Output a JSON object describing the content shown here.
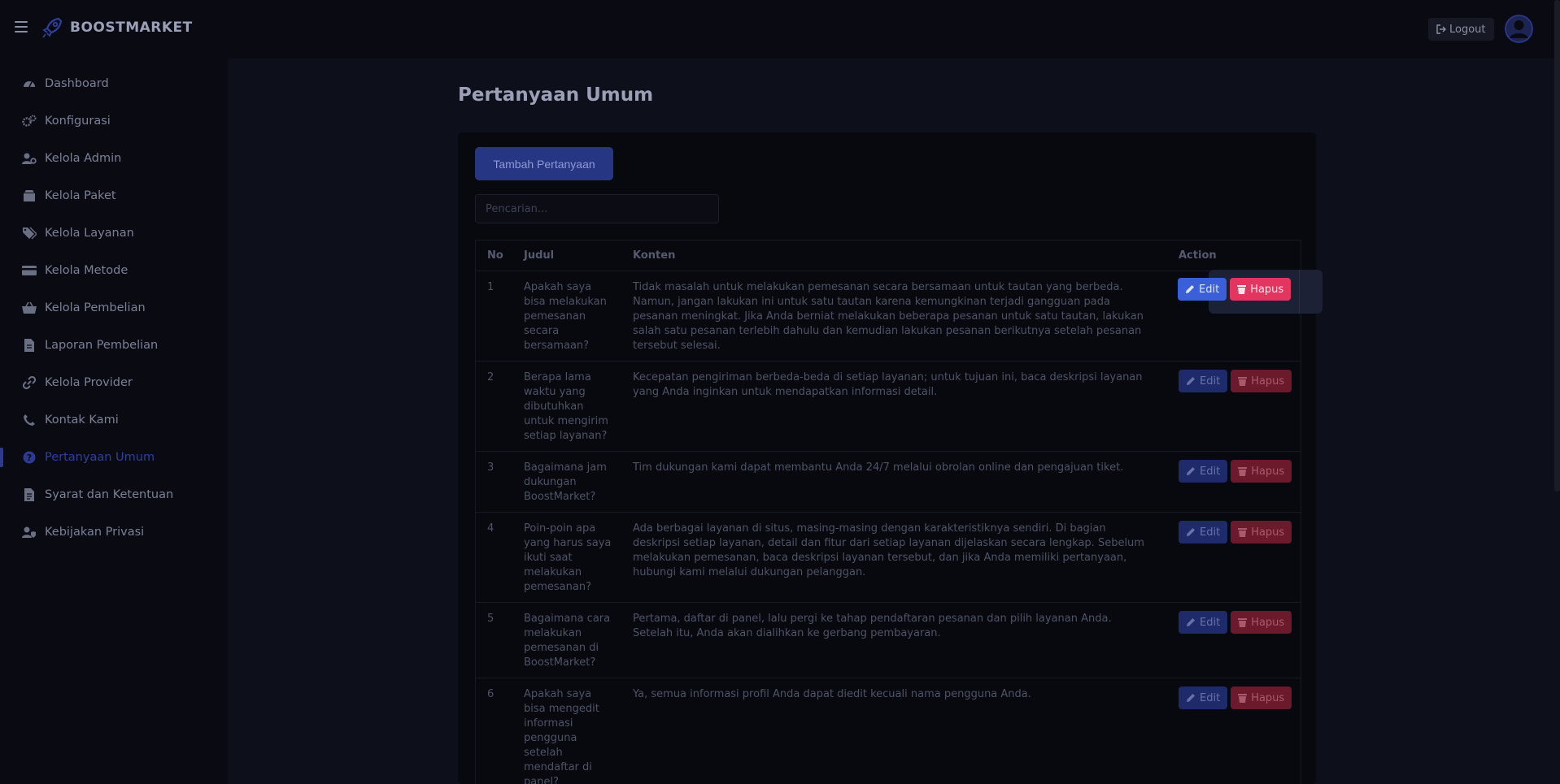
{
  "brand": {
    "name": "BOOSTMARKET"
  },
  "topbar": {
    "logout_label": "Logout"
  },
  "sidebar": {
    "items": [
      {
        "label": "Dashboard",
        "icon": "gauge-icon"
      },
      {
        "label": "Konfigurasi",
        "icon": "cogs-icon"
      },
      {
        "label": "Kelola Admin",
        "icon": "user-cog-icon"
      },
      {
        "label": "Kelola Paket",
        "icon": "box-icon"
      },
      {
        "label": "Kelola Layanan",
        "icon": "tags-icon"
      },
      {
        "label": "Kelola Metode",
        "icon": "credit-card-icon"
      },
      {
        "label": "Kelola Pembelian",
        "icon": "basket-icon"
      },
      {
        "label": "Laporan Pembelian",
        "icon": "file-icon"
      },
      {
        "label": "Kelola Provider",
        "icon": "link-icon"
      },
      {
        "label": "Kontak Kami",
        "icon": "phone-icon"
      },
      {
        "label": "Pertanyaan Umum",
        "icon": "question-circle-icon",
        "active": true
      },
      {
        "label": "Syarat dan Ketentuan",
        "icon": "file-text-icon"
      },
      {
        "label": "Kebijakan Privasi",
        "icon": "user-shield-icon"
      }
    ]
  },
  "main": {
    "title": "Pertanyaan Umum",
    "add_button": "Tambah Pertanyaan",
    "search_placeholder": "Pencarian..."
  },
  "table": {
    "headers": {
      "no": "No",
      "judul": "Judul",
      "konten": "Konten",
      "action": "Action"
    },
    "edit_label": "Edit",
    "hapus_label": "Hapus",
    "rows": [
      {
        "no": "1",
        "judul": "Apakah saya bisa melakukan pemesanan secara bersamaan?",
        "konten": "Tidak masalah untuk melakukan pemesanan secara bersamaan untuk tautan yang berbeda. Namun, jangan lakukan ini untuk satu tautan karena kemungkinan terjadi gangguan pada pesanan meningkat. Jika Anda berniat melakukan beberapa pesanan untuk satu tautan, lakukan salah satu pesanan terlebih dahulu dan kemudian lakukan pesanan berikutnya setelah pesanan tersebut selesai."
      },
      {
        "no": "2",
        "judul": "Berapa lama waktu yang dibutuhkan untuk mengirim setiap layanan?",
        "konten": "Kecepatan pengiriman berbeda-beda di setiap layanan; untuk tujuan ini, baca deskripsi layanan yang Anda inginkan untuk mendapatkan informasi detail."
      },
      {
        "no": "3",
        "judul": "Bagaimana jam dukungan BoostMarket?",
        "konten": "Tim dukungan kami dapat membantu Anda 24/7 melalui obrolan online dan pengajuan tiket."
      },
      {
        "no": "4",
        "judul": "Poin-poin apa yang harus saya ikuti saat melakukan pemesanan?",
        "konten": "Ada berbagai layanan di situs, masing-masing dengan karakteristiknya sendiri. Di bagian deskripsi setiap layanan, detail dan fitur dari setiap layanan dijelaskan secara lengkap. Sebelum melakukan pemesanan, baca deskripsi layanan tersebut, dan jika Anda memiliki pertanyaan, hubungi kami melalui dukungan pelanggan."
      },
      {
        "no": "5",
        "judul": "Bagaimana cara melakukan pemesanan di BoostMarket?",
        "konten": "Pertama, daftar di panel, lalu pergi ke tahap pendaftaran pesanan dan pilih layanan Anda. Setelah itu, Anda akan dialihkan ke gerbang pembayaran."
      },
      {
        "no": "6",
        "judul": "Apakah saya bisa mengedit informasi pengguna setelah mendaftar di panel?",
        "konten": "Ya, semua informasi profil Anda dapat diedit kecuali nama pengguna Anda."
      }
    ]
  },
  "colors": {
    "accent": "#2c3a93",
    "edit": "#3a5fd8",
    "hapus": "#e2355f"
  }
}
